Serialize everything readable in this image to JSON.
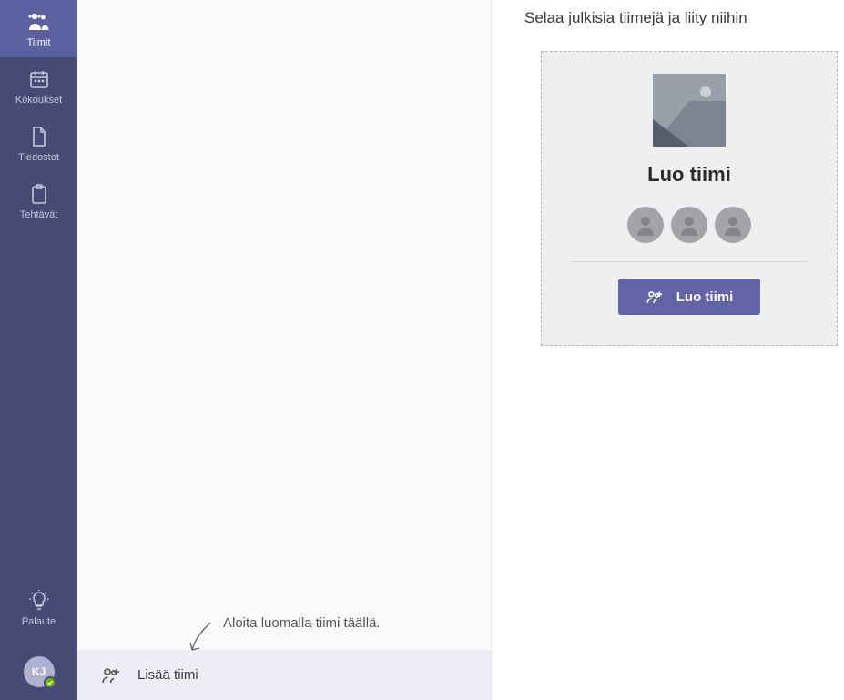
{
  "app_rail": {
    "items": [
      {
        "label": "Tiimit",
        "icon": "teams-icon",
        "active": true
      },
      {
        "label": "Kokoukset",
        "icon": "calendar-icon",
        "active": false
      },
      {
        "label": "Tiedostot",
        "icon": "files-icon",
        "active": false
      },
      {
        "label": "Tehtävät",
        "icon": "tasks-icon",
        "active": false
      }
    ],
    "feedback": {
      "label": "Palaute",
      "icon": "lightbulb-icon"
    },
    "user": {
      "initials": "KJ",
      "presence": "available"
    }
  },
  "mid_col": {
    "hint": "Aloita luomalla tiimi täällä.",
    "add_team_label": "Lisää tiimi"
  },
  "right_col": {
    "heading": "Selaa julkisia tiimejä ja liity niihin",
    "tile": {
      "title": "Luo tiimi",
      "button_label": "Luo tiimi"
    }
  },
  "colors": {
    "accent": "#6264a7",
    "rail_bg": "#464a75"
  }
}
